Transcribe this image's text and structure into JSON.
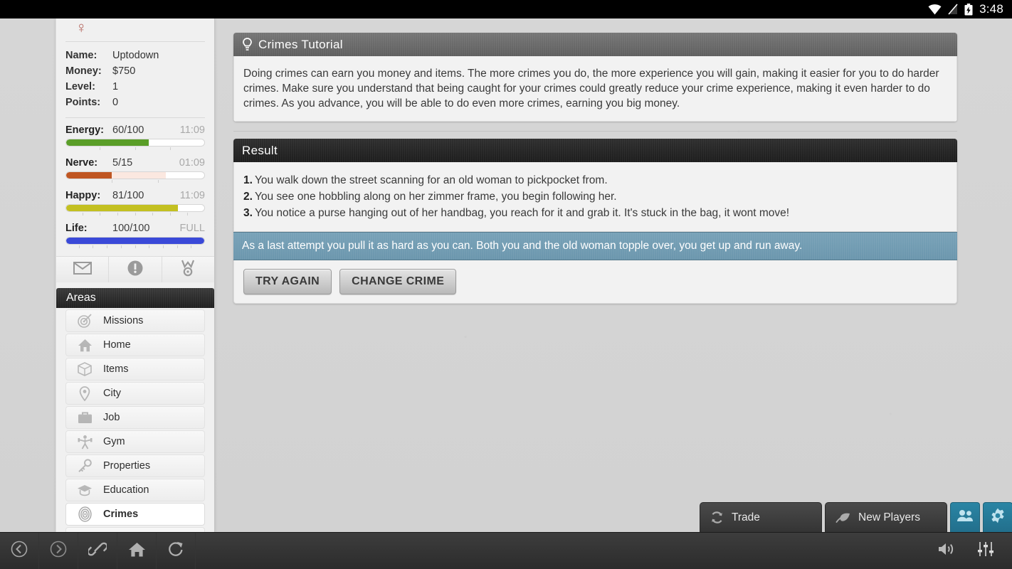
{
  "statusbar": {
    "time": "3:48",
    "icons": [
      "wifi-icon",
      "signal-off-icon",
      "battery-charging-icon"
    ]
  },
  "sidebar": {
    "gender_symbol": "♀",
    "stats": [
      {
        "label": "Name:",
        "value": "Uptodown",
        "style": "name"
      },
      {
        "label": "Money:",
        "value": "$750",
        "style": "money"
      },
      {
        "label": "Level:",
        "value": "1",
        "style": "plain"
      },
      {
        "label": "Points:",
        "value": "0",
        "style": "plain"
      }
    ],
    "bars": [
      {
        "label": "Energy:",
        "value": "60/100",
        "timer": "11:09",
        "percent": 60,
        "secondary": 0,
        "color": "#5a9e28",
        "secondary_color": "#ffffff",
        "ticks": 4
      },
      {
        "label": "Nerve:",
        "value": "5/15",
        "timer": "01:09",
        "percent": 33,
        "secondary": 72,
        "color": "#bf5622",
        "secondary_color": "#fbe8e0",
        "ticks": 3
      },
      {
        "label": "Happy:",
        "value": "81/100",
        "timer": "11:09",
        "percent": 81,
        "secondary": 0,
        "color": "#c3c021",
        "secondary_color": "#ffffff",
        "ticks": 8
      },
      {
        "label": "Life:",
        "value": "100/100",
        "timer": "FULL",
        "percent": 100,
        "secondary": 0,
        "color": "#3a49d8",
        "secondary_color": "#ffffff",
        "ticks": 10
      }
    ],
    "quick_icons": [
      "mail-icon",
      "alert-icon",
      "award-icon"
    ],
    "areas_header": "Areas",
    "nav_items": [
      {
        "label": "Missions",
        "icon": "target-icon",
        "active": false
      },
      {
        "label": "Home",
        "icon": "house-icon",
        "active": false
      },
      {
        "label": "Items",
        "icon": "box-icon",
        "active": false
      },
      {
        "label": "City",
        "icon": "map-pin-icon",
        "active": false
      },
      {
        "label": "Job",
        "icon": "briefcase-icon",
        "active": false
      },
      {
        "label": "Gym",
        "icon": "dumbbell-icon",
        "active": false
      },
      {
        "label": "Properties",
        "icon": "key-icon",
        "active": false
      },
      {
        "label": "Education",
        "icon": "graduation-cap-icon",
        "active": false
      },
      {
        "label": "Crimes",
        "icon": "fingerprint-icon",
        "active": true
      }
    ]
  },
  "main": {
    "tutorial": {
      "title": "Crimes Tutorial",
      "icon": "lightbulb-icon",
      "body": "Doing crimes can earn you money and items. The more crimes you do, the more experience you will gain, making it easier for you to do harder crimes. Make sure you understand that being caught for your crimes could greatly reduce your crime experience, making it even harder to do crimes. As you advance, you will be able to do even more crimes, earning you big money."
    },
    "result": {
      "title": "Result",
      "steps": [
        {
          "n": "1.",
          "text": "You walk down the street scanning for an old woman to pickpocket from."
        },
        {
          "n": "2.",
          "text": "You see one hobbling along on her zimmer frame, you begin following her."
        },
        {
          "n": "3.",
          "text": "You notice a purse hanging out of her handbag, you reach for it and grab it. It's stuck in the bag, it wont move!"
        }
      ],
      "alert": "As a last attempt you pull it as hard as you can. Both you and the old woman topple over, you get up and run away.",
      "buttons": [
        {
          "label": "TRY AGAIN",
          "name": "try-again-button"
        },
        {
          "label": "CHANGE CRIME",
          "name": "change-crime-button"
        }
      ]
    }
  },
  "chat": {
    "tabs": [
      {
        "label": "Trade",
        "icon": "refresh-cycle-icon"
      },
      {
        "label": "New Players",
        "icon": "leaf-icon"
      }
    ],
    "buttons": [
      "people-icon",
      "gear-icon"
    ],
    "accent": "#2a85a4"
  },
  "browser_nav": {
    "left": [
      "back-icon",
      "forward-icon",
      "link-icon",
      "home-icon",
      "reload-icon"
    ],
    "right": [
      "volume-icon",
      "sliders-icon"
    ]
  }
}
